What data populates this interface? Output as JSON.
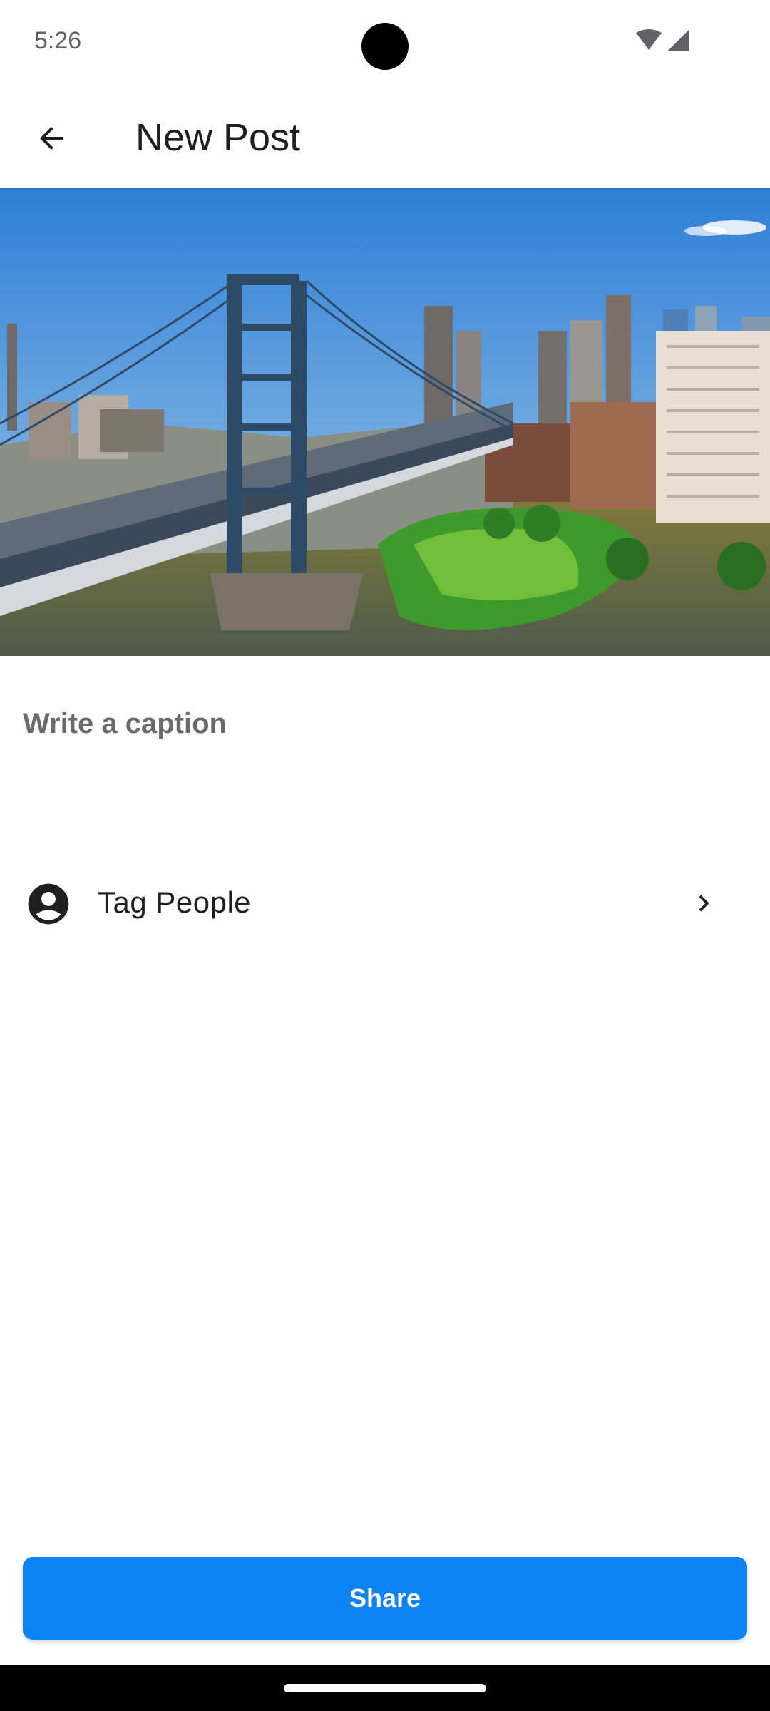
{
  "status_bar": {
    "time": "5:26",
    "icons": [
      "wifi-icon",
      "signal-icon"
    ]
  },
  "app_bar": {
    "title": "New Post",
    "back_icon": "arrow-back-icon"
  },
  "post": {
    "image_subject": "aerial city bridge photo",
    "caption": {
      "placeholder": "Write a caption",
      "value": ""
    }
  },
  "tag_people": {
    "label": "Tag People",
    "icon": "account-circle-icon",
    "trailing_icon": "chevron-right-icon"
  },
  "share_button": {
    "label": "Share",
    "color": "#0a84f2"
  },
  "colors": {
    "background": "#ffffff",
    "primary": "#0a84f2",
    "text": "#1f1f1f",
    "placeholder": "#6b6b6b"
  }
}
